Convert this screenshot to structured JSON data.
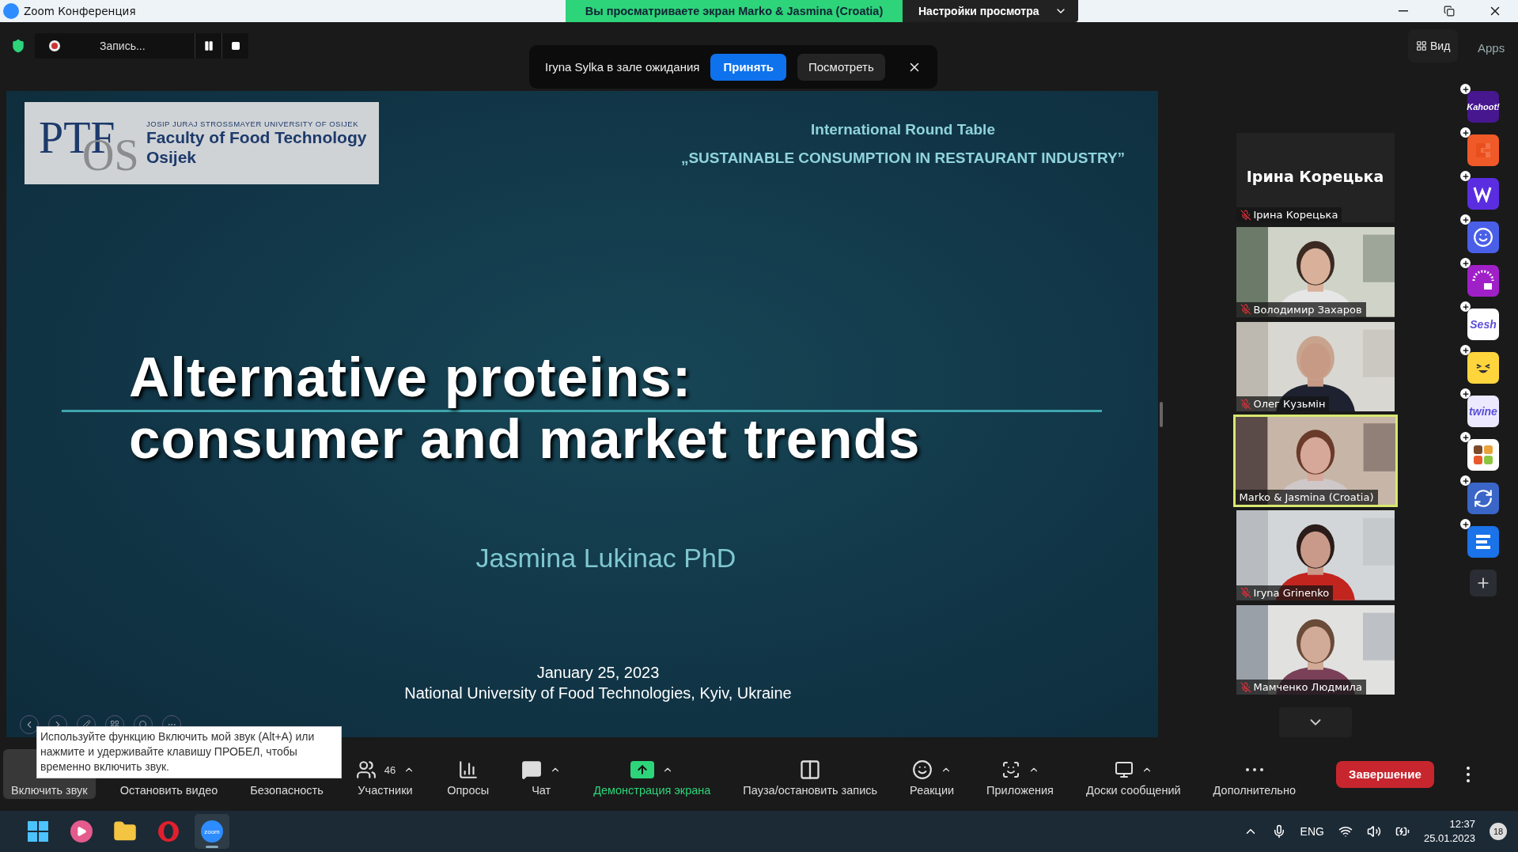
{
  "window": {
    "title": "Zoom Конференция"
  },
  "share_banner": {
    "text": "Вы просматриваете экран Marko & Jasmina (Croatia)",
    "settings": "Настройки просмотра"
  },
  "recording": {
    "label": "Запись..."
  },
  "waiting_notice": {
    "text": "Iryna Sylka в зале ожидания",
    "accept": "Принять",
    "view": "Посмотреть"
  },
  "view_button": "Вид",
  "apps_label": "Apps",
  "slide": {
    "logo": {
      "mark_top": "PTF",
      "mark_bottom": "OS",
      "university": "JOSIP JURAJ STROSSMAYER UNIVERSITY OF OSIJEK",
      "faculty": "Faculty of Food Technology",
      "city": "Osijek"
    },
    "event": "International Round Table",
    "event_title": "„SUSTAINABLE CONSUMPTION IN RESTAURANT INDUSTRY”",
    "title_lines": [
      "Alternative proteins:",
      "consumer and market trends"
    ],
    "author": "Jasmina Lukinac PhD",
    "date": "January 25, 2023",
    "venue": "National University of Food Technologies, Kyiv, Ukraine"
  },
  "participants": [
    {
      "name": "Ірина Корецька",
      "tile_name": "Ірина Корецька",
      "video": false,
      "muted": true,
      "selected": false
    },
    {
      "name": "Володимир Захаров",
      "video": true,
      "muted": true,
      "selected": false
    },
    {
      "name": "Олег Кузьмін",
      "video": true,
      "muted": true,
      "selected": false
    },
    {
      "name": "Marko & Jasmina (Croatia)",
      "video": true,
      "muted": false,
      "selected": true
    },
    {
      "name": "Iryna Grinenko",
      "video": true,
      "muted": true,
      "selected": false
    },
    {
      "name": "Мамченко Людмила",
      "video": true,
      "muted": true,
      "selected": false
    }
  ],
  "apps": [
    {
      "kind": "text",
      "label": "Kahoot!",
      "color": "#46178f"
    },
    {
      "kind": "letter-c",
      "color": "#f05a28"
    },
    {
      "kind": "wave",
      "color": "#5b2de0"
    },
    {
      "kind": "smile",
      "color": "#4a5fe8"
    },
    {
      "kind": "rays",
      "color": "#a020c8"
    },
    {
      "kind": "text",
      "label": "Sesh",
      "color": "#ffffff"
    },
    {
      "kind": "emoji",
      "color": "#ffd53d"
    },
    {
      "kind": "text",
      "label": "twine",
      "color": "#ece9ff"
    },
    {
      "kind": "blocks",
      "color": "#ffffff"
    },
    {
      "kind": "sync",
      "color": "#3a66c8"
    },
    {
      "kind": "stripes",
      "color": "#1a73e8"
    }
  ],
  "tooltip": "Используйте функцию Включить мой звук (Alt+A) или нажмите и удерживайте клавишу ПРОБЕЛ, чтобы временно включить звук.",
  "toolbar": [
    {
      "kind": "audio",
      "label": "Включить звук"
    },
    {
      "kind": "video",
      "label": "Остановить видео"
    },
    {
      "kind": "security",
      "label": "Безопасность"
    },
    {
      "kind": "participants",
      "label": "Участники",
      "count": "46",
      "caret": true
    },
    {
      "kind": "polls",
      "label": "Опросы",
      "caret": false
    },
    {
      "kind": "chat",
      "label": "Чат",
      "caret": true
    },
    {
      "kind": "share",
      "label": "Демонстрация экрана",
      "caret": true
    },
    {
      "kind": "record",
      "label": "Пауза/остановить запись",
      "caret": false
    },
    {
      "kind": "reactions",
      "label": "Реакции",
      "caret": true
    },
    {
      "kind": "apps",
      "label": "Приложения",
      "caret": true
    },
    {
      "kind": "whiteboard",
      "label": "Доски сообщений",
      "caret": true
    },
    {
      "kind": "more",
      "label": "Дополнительно",
      "caret": false
    }
  ],
  "end_button": "Завершение",
  "taskbar": {
    "apps": [
      {
        "kind": "windows",
        "active": false
      },
      {
        "kind": "player",
        "active": false
      },
      {
        "kind": "folder",
        "active": false
      },
      {
        "kind": "opera",
        "active": false
      },
      {
        "kind": "zoom",
        "label": "zoom",
        "active": true
      }
    ],
    "language": "ENG",
    "time": "12:37",
    "date": "25.01.2023",
    "notifications": "18"
  }
}
